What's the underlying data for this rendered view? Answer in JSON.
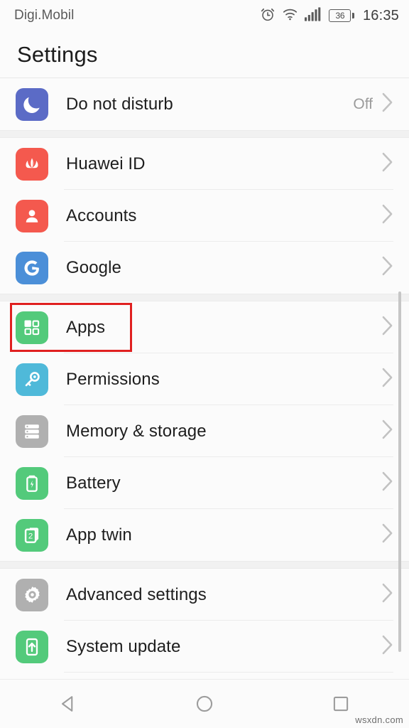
{
  "status_bar": {
    "carrier": "Digi.Mobil",
    "clock": "16:35",
    "battery_percent": "36",
    "icons": [
      "alarm-icon",
      "wifi-icon",
      "signal-icon",
      "battery-icon"
    ]
  },
  "header": {
    "title": "Settings"
  },
  "colors": {
    "highlight": "#e02020",
    "dnd": "#5b6bc6",
    "huawei": "#f4594e",
    "accounts": "#f4594e",
    "google": "#4b8fd8",
    "apps": "#53ca7b",
    "permissions": "#4fb9d9",
    "memory": "#b0b0b0",
    "battery": "#53ca7b",
    "app_twin": "#53ca7b",
    "advanced": "#b0b0b0",
    "system_update": "#53ca7b",
    "page_background": "#fbfbfb",
    "section_gap": "#f1f1f1"
  },
  "sections": [
    {
      "rows": [
        {
          "label": "Do not disturb",
          "value": "Off",
          "icon": "moon-icon",
          "icon_color": "#5b6bc6",
          "highlighted": false
        }
      ]
    },
    {
      "rows": [
        {
          "label": "Huawei ID",
          "value": "",
          "icon": "huawei-logo-icon",
          "icon_color": "#f4594e",
          "highlighted": false
        },
        {
          "label": "Accounts",
          "value": "",
          "icon": "person-icon",
          "icon_color": "#f4594e",
          "highlighted": false
        },
        {
          "label": "Google",
          "value": "",
          "icon": "google-g-icon",
          "icon_color": "#4b8fd8",
          "highlighted": false
        }
      ]
    },
    {
      "rows": [
        {
          "label": "Apps",
          "value": "",
          "icon": "apps-grid-icon",
          "icon_color": "#53ca7b",
          "highlighted": true
        },
        {
          "label": "Permissions",
          "value": "",
          "icon": "key-icon",
          "icon_color": "#4fb9d9",
          "highlighted": false
        },
        {
          "label": "Memory & storage",
          "value": "",
          "icon": "storage-icon",
          "icon_color": "#b0b0b0",
          "highlighted": false
        },
        {
          "label": "Battery",
          "value": "",
          "icon": "battery-icon",
          "icon_color": "#53ca7b",
          "highlighted": false
        },
        {
          "label": "App twin",
          "value": "",
          "icon": "app-twin-icon",
          "icon_color": "#53ca7b",
          "highlighted": false
        }
      ]
    },
    {
      "rows": [
        {
          "label": "Advanced settings",
          "value": "",
          "icon": "gear-icon",
          "icon_color": "#b0b0b0",
          "highlighted": false
        },
        {
          "label": "System update",
          "value": "",
          "icon": "system-update-icon",
          "icon_color": "#53ca7b",
          "highlighted": false
        }
      ]
    }
  ],
  "nav_bar": {
    "back": "back-triangle-icon",
    "home": "home-circle-icon",
    "recents": "recents-square-icon"
  },
  "watermark": "wsxdn.com"
}
